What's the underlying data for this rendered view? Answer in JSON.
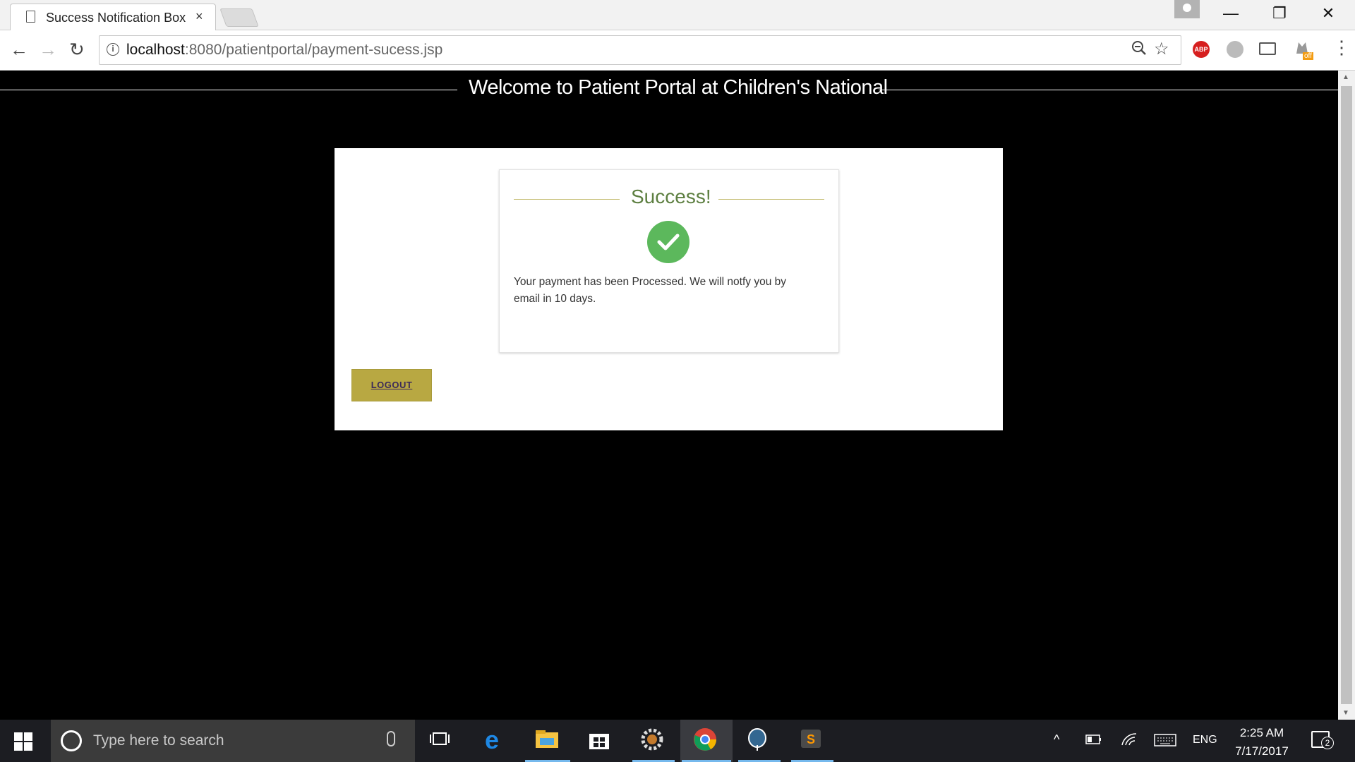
{
  "browser": {
    "tab_title": "Success Notification Box",
    "tab_close": "×",
    "url_host": "localhost",
    "url_path": ":8080/patientportal/payment-sucess.jsp",
    "ext_abp": "ABP",
    "ext_off": "off",
    "window_minimize": "—",
    "window_restore": "❐",
    "window_close": "✕"
  },
  "page": {
    "welcome": "Welcome to Patient Portal at Children's National",
    "success_title": "Success!",
    "message": "Your payment has been Processed. We will notfy you by email in 10 days.",
    "logout_label": "LOGOUT",
    "check_color": "#5cb85c",
    "button_color": "#b8a842"
  },
  "taskbar": {
    "search_placeholder": "Type here to search",
    "language": "ENG",
    "time": "2:25 AM",
    "date": "7/17/2017",
    "notification_count": "2"
  }
}
